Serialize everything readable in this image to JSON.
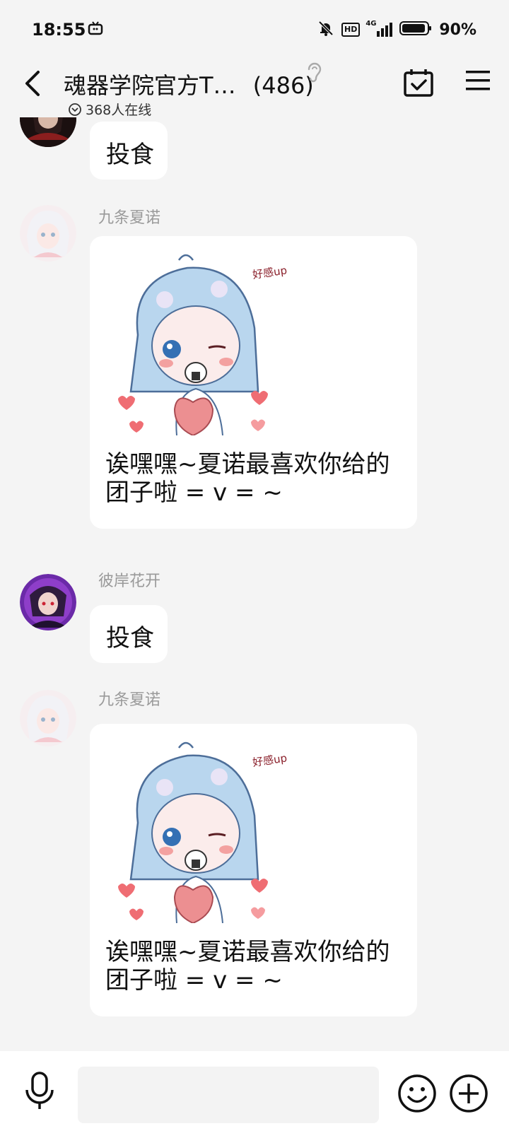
{
  "status_bar": {
    "time": "18:55",
    "network": "4G",
    "hd": "HD",
    "battery": "90%"
  },
  "header": {
    "title": "魂器学院官方T…",
    "member_count": "(486)",
    "online": "368人在线"
  },
  "messages": [
    {
      "sender": "",
      "text": "投食",
      "avatar": "dark-hair-character"
    },
    {
      "sender": "九条夏诺",
      "caption": "诶嘿嘿~夏诺最喜欢你给的团子啦 = v = ~",
      "sticker_text": "好感up",
      "avatar": "white-hair-girl"
    },
    {
      "sender": "彼岸花开",
      "text": "投食",
      "avatar": "purple-hair-character"
    },
    {
      "sender": "九条夏诺",
      "caption": "诶嘿嘿~夏诺最喜欢你给的团子啦 = v = ~",
      "sticker_text": "好感up",
      "avatar": "white-hair-girl"
    }
  ],
  "caption_lines": [
    "诶嘿嘿~夏诺最喜欢你给的",
    "团子啦 = v = ~"
  ],
  "input": {
    "placeholder": ""
  },
  "icons": {
    "back": "chevron-left-icon",
    "ear": "ear-icon",
    "calendar": "calendar-check-icon",
    "menu": "menu-icon",
    "voice": "microphone-icon",
    "emoji": "smiley-icon",
    "plus": "plus-circle-icon"
  }
}
